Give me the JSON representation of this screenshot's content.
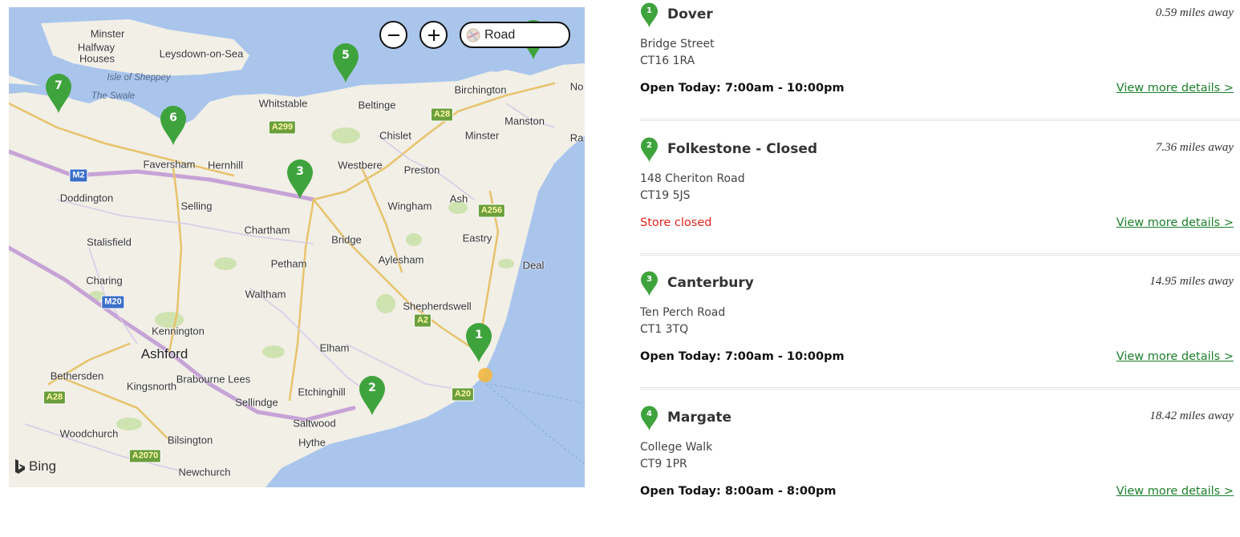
{
  "map": {
    "zoom_out_label": "−",
    "zoom_in_label": "+",
    "map_type": "Road",
    "attribution": "Bing",
    "town_labels": [
      {
        "text": "Minster",
        "big": false
      },
      {
        "text": "Halfway",
        "big": false
      },
      {
        "text": "Houses",
        "big": false
      },
      {
        "text": "Leysdown-on-Sea",
        "big": false
      },
      {
        "text": "Isle of Sheppey",
        "water": true
      },
      {
        "text": "The Swale",
        "water": true
      },
      {
        "text": "Whitstable",
        "big": false
      },
      {
        "text": "Beltinge",
        "big": false
      },
      {
        "text": "Birchington",
        "big": false
      },
      {
        "text": "Manston",
        "big": false
      },
      {
        "text": "Chislet",
        "big": false
      },
      {
        "text": "Minster",
        "big": false
      },
      {
        "text": "Faversham",
        "big": false
      },
      {
        "text": "Hernhill",
        "big": false
      },
      {
        "text": "Westbere",
        "big": false
      },
      {
        "text": "Preston",
        "big": false
      },
      {
        "text": "Doddington",
        "big": false
      },
      {
        "text": "Selling",
        "big": false
      },
      {
        "text": "Wingham",
        "big": false
      },
      {
        "text": "Ash",
        "big": false
      },
      {
        "text": "Chartham",
        "big": false
      },
      {
        "text": "Bridge",
        "big": false
      },
      {
        "text": "Eastry",
        "big": false
      },
      {
        "text": "Stalisfield",
        "big": false
      },
      {
        "text": "Petham",
        "big": false
      },
      {
        "text": "Aylesham",
        "big": false
      },
      {
        "text": "Deal",
        "big": false
      },
      {
        "text": "Charing",
        "big": false
      },
      {
        "text": "Waltham",
        "big": false
      },
      {
        "text": "Shepherdswell",
        "big": false
      },
      {
        "text": "Kennington",
        "big": false
      },
      {
        "text": "Ashford",
        "big": true
      },
      {
        "text": "Elham",
        "big": false
      },
      {
        "text": "Bethersden",
        "big": false
      },
      {
        "text": "Brabourne Lees",
        "big": false
      },
      {
        "text": "Kingsnorth",
        "big": false
      },
      {
        "text": "Etchinghill",
        "big": false
      },
      {
        "text": "Sellindge",
        "big": false
      },
      {
        "text": "Saltwood",
        "big": false
      },
      {
        "text": "Woodchurch",
        "big": false
      },
      {
        "text": "Bilsington",
        "big": false
      },
      {
        "text": "Hythe",
        "big": false
      },
      {
        "text": "Newchurch",
        "big": false
      },
      {
        "text": "No",
        "big": false
      },
      {
        "text": "Ra",
        "big": false
      }
    ],
    "road_shields": [
      {
        "text": "A299",
        "kind": "a"
      },
      {
        "text": "A28",
        "kind": "a"
      },
      {
        "text": "M2",
        "kind": "m"
      },
      {
        "text": "A256",
        "kind": "a"
      },
      {
        "text": "M20",
        "kind": "m"
      },
      {
        "text": "A2",
        "kind": "a"
      },
      {
        "text": "A28",
        "kind": "a"
      },
      {
        "text": "A20",
        "kind": "a"
      },
      {
        "text": "A2070",
        "kind": "a"
      }
    ],
    "pins": [
      "1",
      "2",
      "3",
      "5",
      "6",
      "7"
    ],
    "colors": {
      "land": "#f1efe6",
      "sea": "#a9c5ec",
      "pin": "#3fa33d",
      "green": "#cfe3b1"
    }
  },
  "stores": [
    {
      "number": "1",
      "name": "Dover",
      "distance": "0.59 miles away",
      "address1": "Bridge Street",
      "address2": "CT16 1RA",
      "hours": "Open Today: 7:00am - 10:00pm",
      "closed": "",
      "more": "View more details >"
    },
    {
      "number": "2",
      "name": "Folkestone - Closed",
      "distance": "7.36 miles away",
      "address1": "148 Cheriton Road",
      "address2": "CT19 5JS",
      "hours": "",
      "closed": "Store closed",
      "more": "View more details >"
    },
    {
      "number": "3",
      "name": "Canterbury",
      "distance": "14.95 miles away",
      "address1": "Ten Perch Road",
      "address2": "CT1 3TQ",
      "hours": "Open Today: 7:00am - 10:00pm",
      "closed": "",
      "more": "View more details >"
    },
    {
      "number": "4",
      "name": "Margate",
      "distance": "18.42 miles away",
      "address1": "College Walk",
      "address2": "CT9 1PR",
      "hours": "Open Today: 8:00am - 8:00pm",
      "closed": "",
      "more": "View more details >"
    }
  ]
}
